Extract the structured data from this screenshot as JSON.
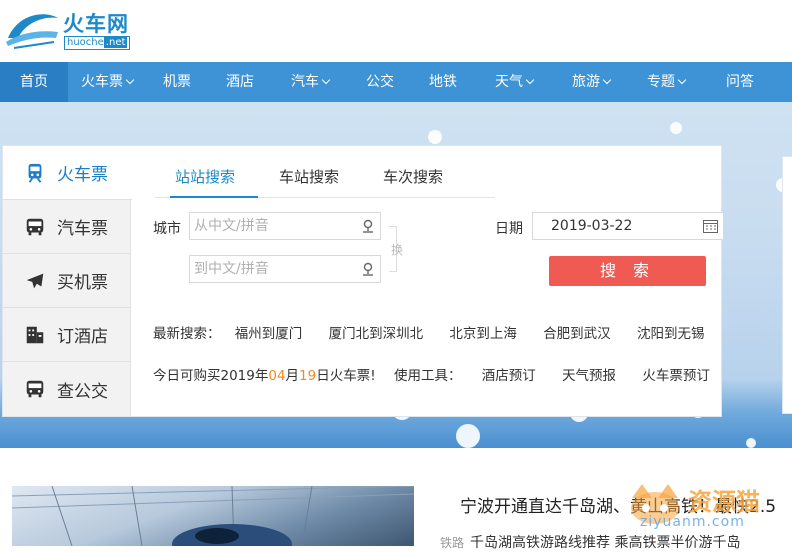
{
  "logo": {
    "title": "火车网",
    "domain": "huoche",
    "domain_tld": ".net"
  },
  "nav": {
    "items": [
      {
        "label": "首页",
        "active": true,
        "dropdown": false
      },
      {
        "label": "火车票",
        "dropdown": true
      },
      {
        "label": "机票",
        "dropdown": false
      },
      {
        "label": "酒店",
        "dropdown": false
      },
      {
        "label": "汽车",
        "dropdown": true
      },
      {
        "label": "公交",
        "dropdown": false
      },
      {
        "label": "地铁",
        "dropdown": false
      },
      {
        "label": "天气",
        "dropdown": true
      },
      {
        "label": "旅游",
        "dropdown": true
      },
      {
        "label": "专题",
        "dropdown": true
      },
      {
        "label": "问答",
        "dropdown": false
      }
    ]
  },
  "side_tabs": [
    {
      "label": "火车票",
      "icon": "train-icon",
      "active": true
    },
    {
      "label": "汽车票",
      "icon": "bus-icon"
    },
    {
      "label": "买机票",
      "icon": "plane-icon"
    },
    {
      "label": "订酒店",
      "icon": "hotel-icon"
    },
    {
      "label": "查公交",
      "icon": "bus-icon"
    }
  ],
  "search_tabs": [
    "站站搜索",
    "车站搜索",
    "车次搜索"
  ],
  "form": {
    "city_label": "城市",
    "from_placeholder": "从中文/拼音",
    "to_placeholder": "到中文/拼音",
    "swap_label": "换",
    "date_label": "日期",
    "date_value": "2019-03-22",
    "search_button": "搜 索"
  },
  "latest": {
    "label": "最新搜索：",
    "links": [
      "福州到厦门",
      "厦门北到深圳北",
      "北京到上海",
      "合肥到武汉",
      "沈阳到无锡"
    ]
  },
  "tools": {
    "prefix": "今日可购买2019年",
    "month": "04",
    "month_suffix": "月",
    "day": "19",
    "suffix": "日火车票!",
    "tools_label": "使用工具：",
    "links": [
      "酒店预订",
      "天气预报",
      "火车票预订"
    ]
  },
  "news": {
    "title": "宁波开通直达千岛湖、黄山高铁！最快2.5",
    "tag": "铁路",
    "sub": "千岛湖高铁游路线推荐 乘高铁票半价游千岛"
  },
  "watermark": {
    "text": "资源猫",
    "url": "ziyuanm.com"
  },
  "colors": {
    "nav": "#3d93d6",
    "brand": "#1d89c8",
    "search_button": "#ef5a52",
    "highlight": "#f08a24"
  }
}
